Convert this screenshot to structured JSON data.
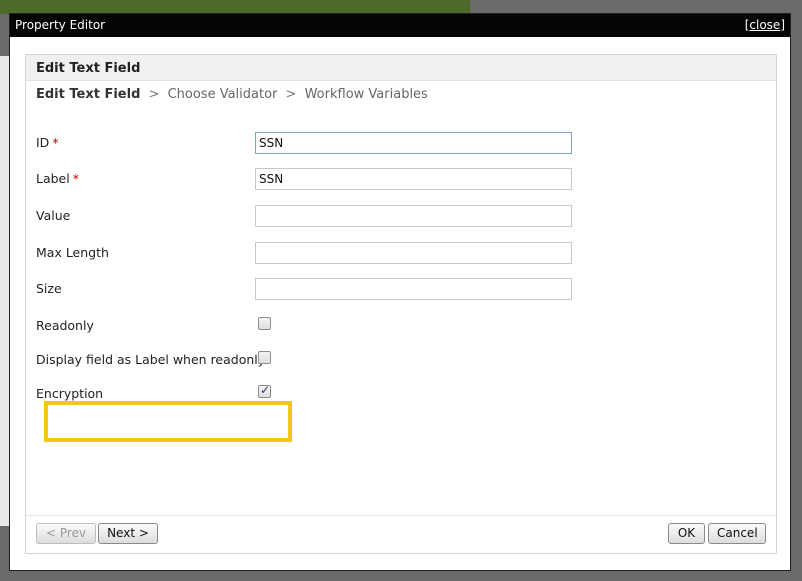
{
  "window": {
    "title": "Property Editor",
    "close_label": "close",
    "close_bracket_open": "[",
    "close_bracket_close": "]"
  },
  "panel": {
    "header": "Edit Text Field"
  },
  "breadcrumb": {
    "current": "Edit Text Field",
    "steps": [
      "Choose Validator",
      "Workflow Variables"
    ],
    "separator": ">"
  },
  "fields": {
    "id": {
      "label": "ID",
      "required_mark": "*",
      "value": "SSN"
    },
    "label": {
      "label": "Label",
      "required_mark": "*",
      "value": "SSN"
    },
    "value": {
      "label": "Value",
      "value": ""
    },
    "max_length": {
      "label": "Max Length",
      "value": ""
    },
    "size": {
      "label": "Size",
      "value": ""
    },
    "readonly": {
      "label": "Readonly",
      "checked": false
    },
    "display_as_label": {
      "label": "Display field as Label when readonly?",
      "checked": false
    },
    "encryption": {
      "label": "Encryption",
      "checked": true
    }
  },
  "buttons": {
    "prev": "< Prev",
    "next": "Next >",
    "ok": "OK",
    "cancel": "Cancel"
  },
  "colors": {
    "highlight": "#f5c518",
    "required": "#cc0000",
    "titlebar": "#050505"
  }
}
